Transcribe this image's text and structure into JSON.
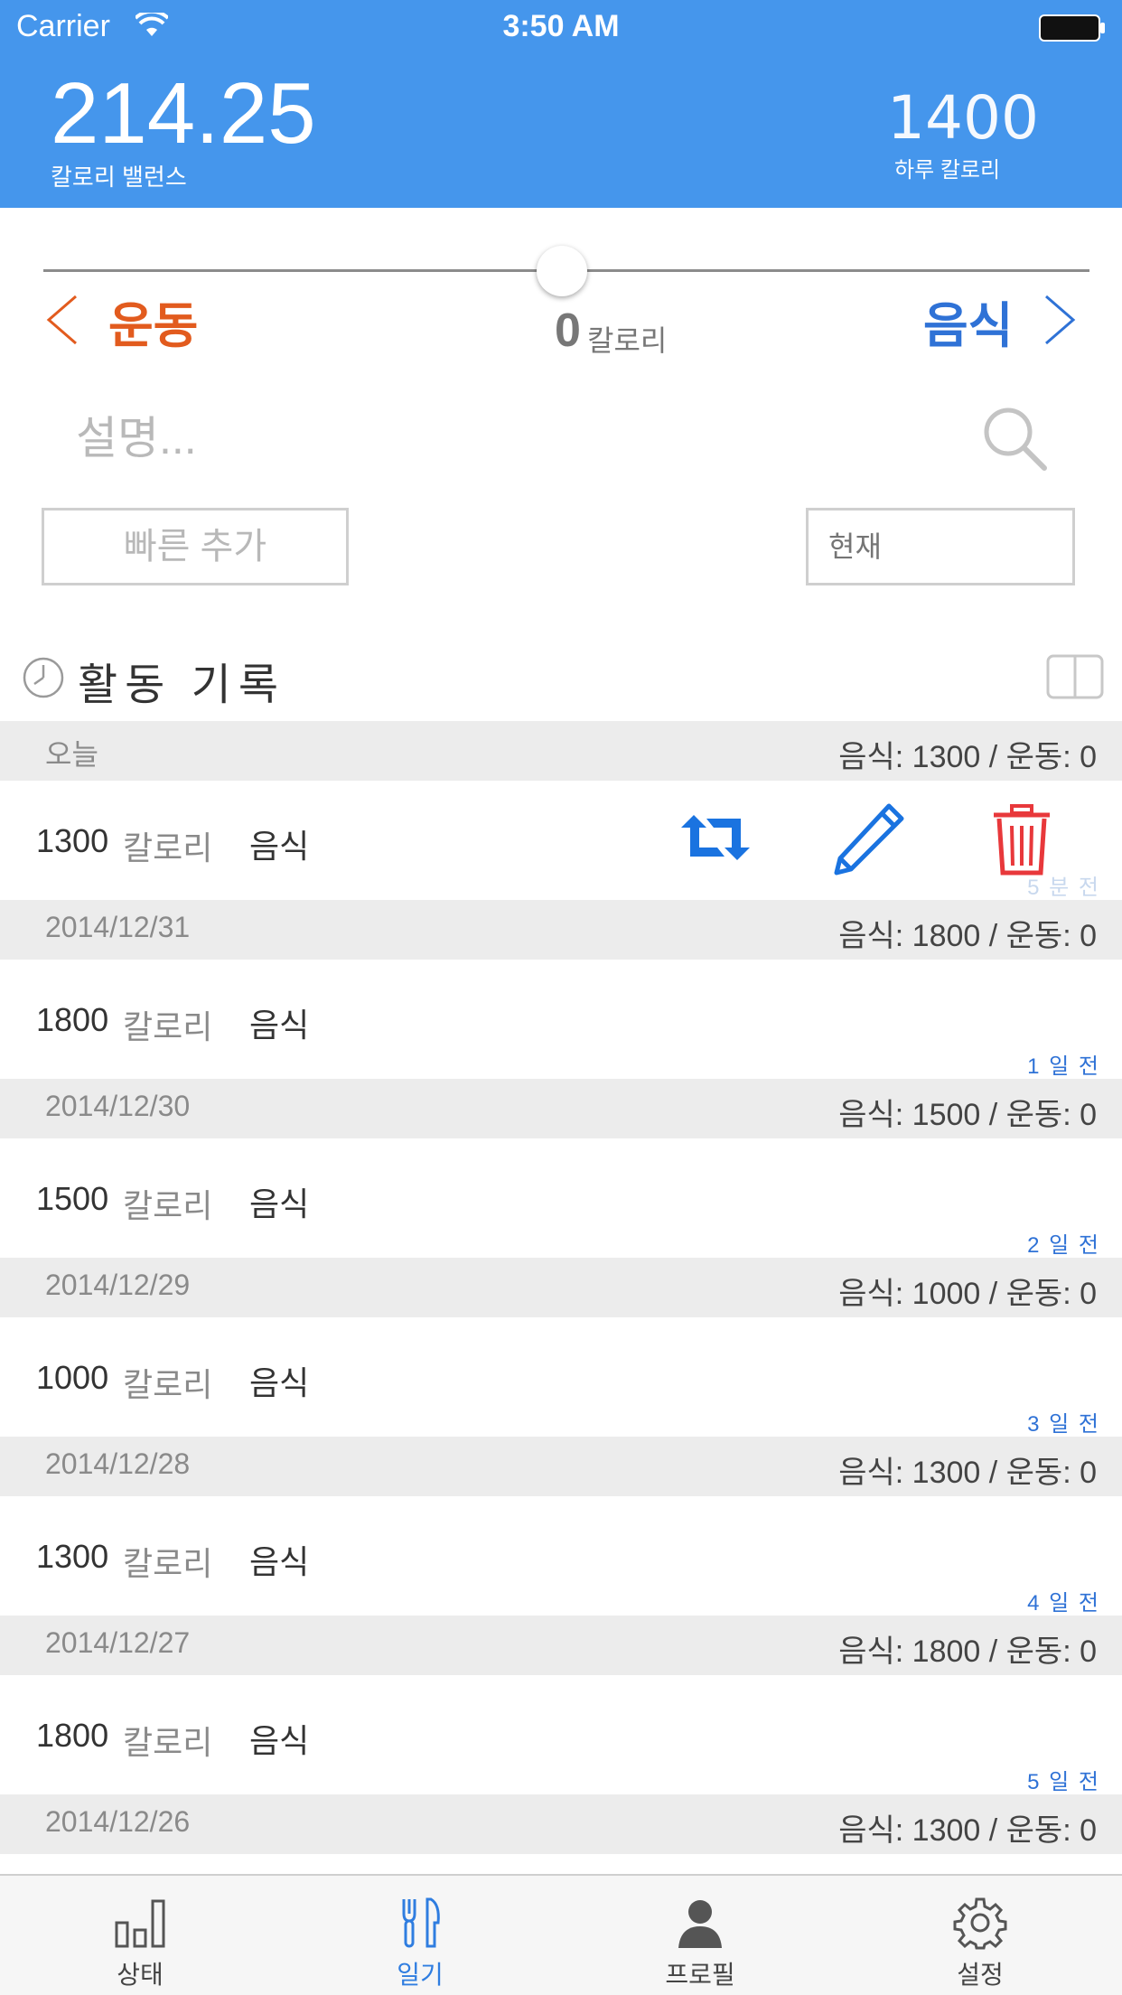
{
  "status_bar": {
    "carrier": "Carrier",
    "time": "3:50 AM"
  },
  "header": {
    "balance_value": "214.25",
    "balance_label": "칼로리 밸런스",
    "daily_value": "1400",
    "daily_label": "하루 칼로리"
  },
  "input_panel": {
    "exercise_label": "운동",
    "food_label": "음식",
    "calorie_amount": "0",
    "calorie_unit": "칼로리",
    "slider_level": 0.5,
    "description_placeholder": "설명...",
    "quick_add_label": "빠른 추가",
    "now_label": "현재"
  },
  "log": {
    "title": "활동 기록",
    "days": [
      {
        "date": "오늘",
        "summary": "음식: 1300 / 운동: 0",
        "entry": {
          "amount": "1300",
          "unit": "칼로리",
          "kind": "음식",
          "time": "5 분 전"
        }
      },
      {
        "date": "2014/12/31",
        "summary": "음식: 1800 / 운동: 0",
        "entry": {
          "amount": "1800",
          "unit": "칼로리",
          "kind": "음식",
          "time": "1 일 전"
        }
      },
      {
        "date": "2014/12/30",
        "summary": "음식: 1500 / 운동: 0",
        "entry": {
          "amount": "1500",
          "unit": "칼로리",
          "kind": "음식",
          "time": "2 일 전"
        }
      },
      {
        "date": "2014/12/29",
        "summary": "음식: 1000 / 운동: 0",
        "entry": {
          "amount": "1000",
          "unit": "칼로리",
          "kind": "음식",
          "time": "3 일 전"
        }
      },
      {
        "date": "2014/12/28",
        "summary": "음식: 1300 / 운동: 0",
        "entry": {
          "amount": "1300",
          "unit": "칼로리",
          "kind": "음식",
          "time": "4 일 전"
        }
      },
      {
        "date": "2014/12/27",
        "summary": "음식: 1800 / 운동: 0",
        "entry": {
          "amount": "1800",
          "unit": "칼로리",
          "kind": "음식",
          "time": "5 일 전"
        }
      },
      {
        "date": "2014/12/26",
        "summary": "음식: 1300 / 운동: 0"
      }
    ]
  },
  "tabbar": {
    "tabs": [
      {
        "label": "상태",
        "icon": "bar-chart-icon"
      },
      {
        "label": "일기",
        "icon": "fork-knife-icon"
      },
      {
        "label": "프로필",
        "icon": "person-icon"
      },
      {
        "label": "설정",
        "icon": "gear-icon"
      }
    ],
    "active": "일기"
  },
  "colors": {
    "header_bg": "#4596ec",
    "exercise": "#e25b1e",
    "food": "#2f72d6",
    "delete": "#e8383b",
    "action_blue": "#1a73e0"
  }
}
